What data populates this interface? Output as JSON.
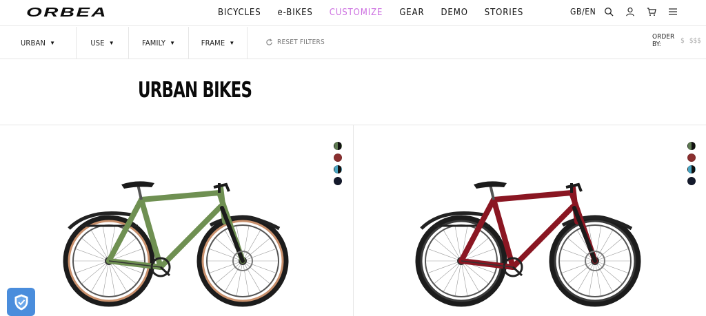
{
  "header": {
    "logo_text": "ORBEA",
    "nav": [
      {
        "label": "BICYCLES",
        "active": false
      },
      {
        "label": "e-BIKES",
        "active": false
      },
      {
        "label": "CUSTOMIZE",
        "active": true
      },
      {
        "label": "GEAR",
        "active": false
      },
      {
        "label": "DEMO",
        "active": false
      },
      {
        "label": "STORIES",
        "active": false
      }
    ],
    "locale": "GB/EN",
    "icons": [
      "search-icon",
      "user-icon",
      "cart-icon",
      "menu-icon"
    ],
    "accent_color": "#cc6fe0"
  },
  "filters": {
    "items": [
      {
        "label": "URBAN"
      },
      {
        "label": "USE"
      },
      {
        "label": "FAMILY"
      },
      {
        "label": "FRAME"
      }
    ],
    "reset_label": "RESET FILTERS",
    "order_by_label": "ORDER BY:",
    "order_options": [
      "$",
      "$$$"
    ]
  },
  "page": {
    "title": "URBAN BIKES"
  },
  "products": [
    {
      "frame_color": "#6f9052",
      "swatches": [
        {
          "a": "#5e7a52",
          "b": "#111111"
        },
        {
          "a": "#8b2f2f",
          "b": "#8b2f2f"
        },
        {
          "a": "#4ba6c4",
          "b": "#111111"
        },
        {
          "a": "#141a2c",
          "b": "#141a2c"
        }
      ]
    },
    {
      "frame_color": "#8a1622",
      "swatches": [
        {
          "a": "#5e7a52",
          "b": "#111111"
        },
        {
          "a": "#8b2f2f",
          "b": "#8b2f2f"
        },
        {
          "a": "#4ba6c4",
          "b": "#111111"
        },
        {
          "a": "#141a2c",
          "b": "#141a2c"
        }
      ]
    }
  ],
  "privacy_badge": {
    "icon": "shield-check-icon",
    "color": "#4a8ddc"
  }
}
